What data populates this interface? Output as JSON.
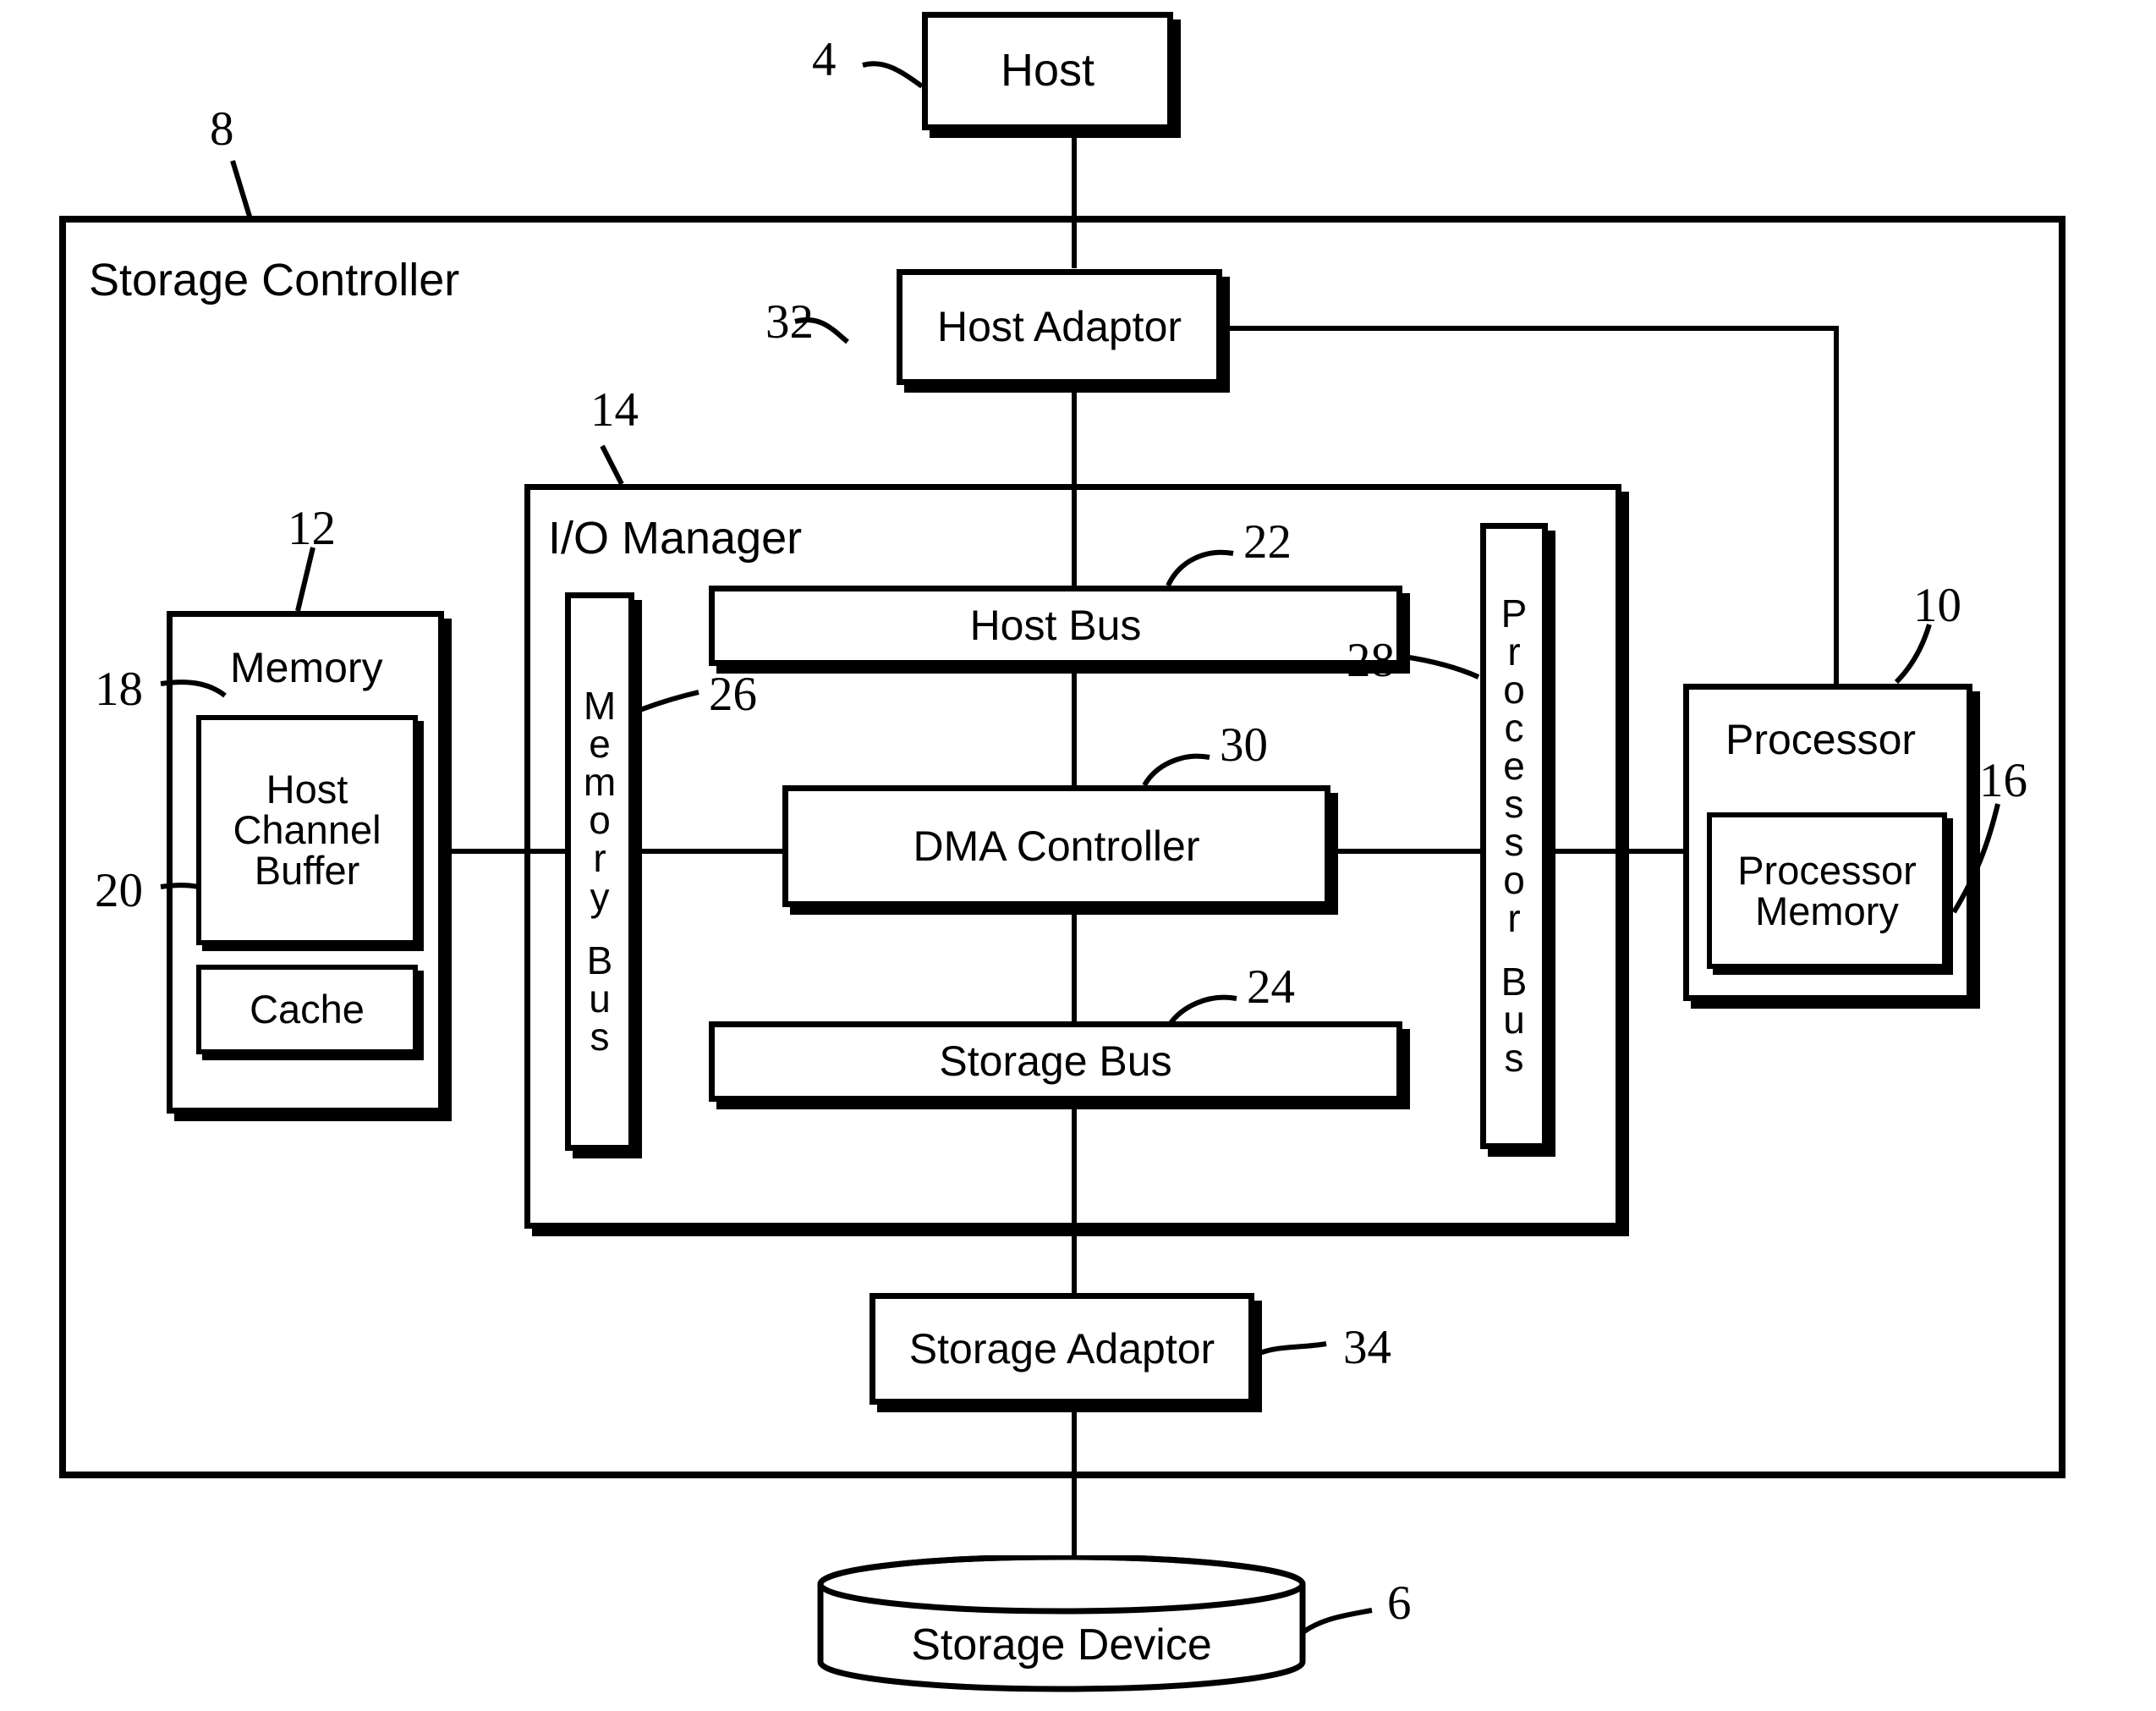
{
  "figure": {
    "type": "patent-block-diagram",
    "background_color": "#ffffff",
    "line_color": "#000000"
  },
  "nodes": {
    "host": {
      "label": "Host",
      "ref": "4"
    },
    "storage_controller": {
      "label": "Storage Controller",
      "ref": "8"
    },
    "host_adaptor": {
      "label": "Host Adaptor",
      "ref": "32"
    },
    "io_manager": {
      "label": "I/O Manager",
      "ref": "14"
    },
    "memory": {
      "label": "Memory",
      "ref": "12"
    },
    "host_channel_buffer": {
      "label_line1": "Host",
      "label_line2": "Channel",
      "label_line3": "Buffer",
      "ref": "18"
    },
    "cache": {
      "label": "Cache",
      "ref": "20"
    },
    "memory_bus": {
      "label": "Memory Bus",
      "letters": [
        "M",
        "e",
        "m",
        "o",
        "r",
        "y",
        "",
        "B",
        "u",
        "s"
      ],
      "ref": "26"
    },
    "host_bus": {
      "label": "Host Bus",
      "ref": "22"
    },
    "dma_controller": {
      "label": "DMA Controller",
      "ref": "30"
    },
    "storage_bus": {
      "label": "Storage Bus",
      "ref": "24"
    },
    "processor_bus": {
      "label": "Processor Bus",
      "letters": [
        "P",
        "r",
        "o",
        "c",
        "e",
        "s",
        "s",
        "o",
        "r",
        "",
        "B",
        "u",
        "s"
      ],
      "ref": "28"
    },
    "processor": {
      "label": "Processor",
      "ref": "10"
    },
    "processor_memory": {
      "label_line1": "Processor",
      "label_line2": "Memory",
      "ref": "16"
    },
    "storage_adaptor": {
      "label": "Storage Adaptor",
      "ref": "34"
    },
    "storage_device": {
      "label": "Storage Device",
      "ref": "6"
    }
  }
}
